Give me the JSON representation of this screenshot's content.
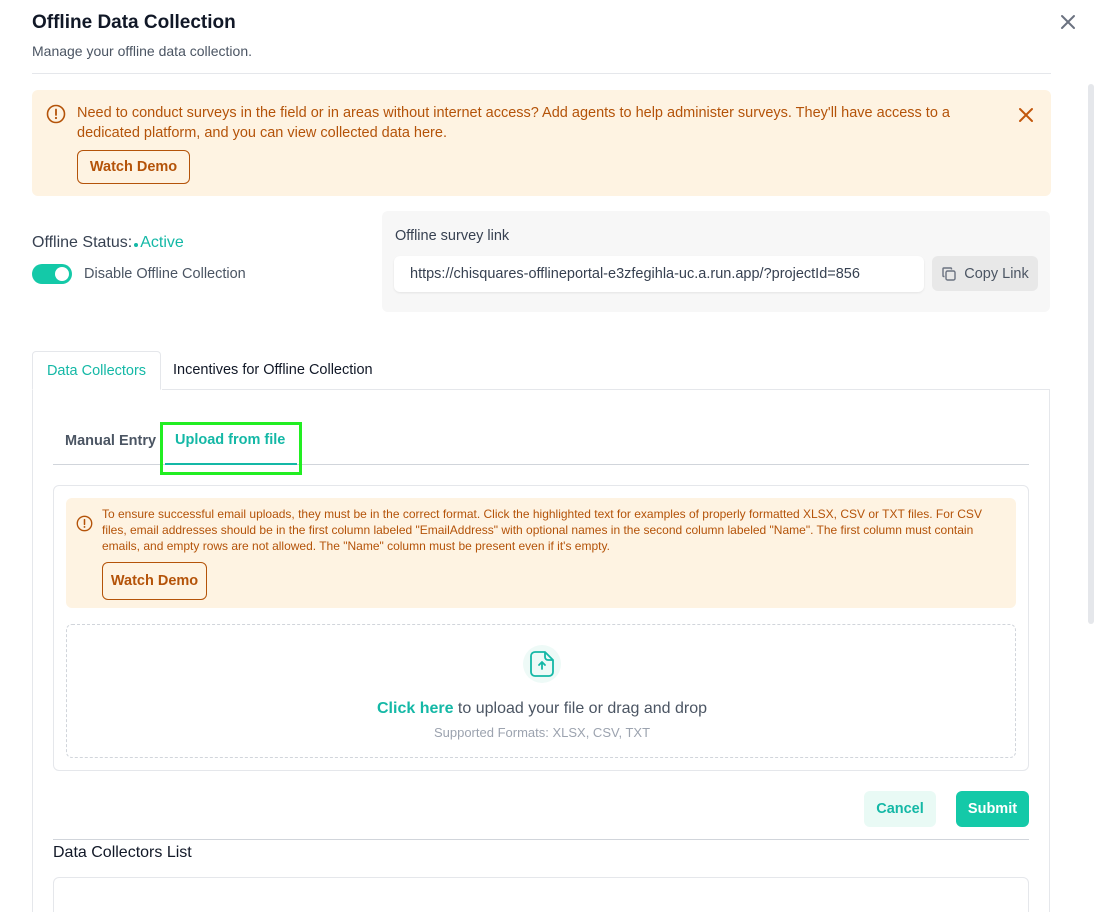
{
  "header": {
    "title": "Offline Data Collection",
    "subtitle": "Manage your offline data collection."
  },
  "banner": {
    "text": "Need to conduct surveys in the field or in areas without internet access? Add agents to help administer surveys. They'll have access to a dedicated platform, and you can view collected data here.",
    "watch_demo": "Watch Demo"
  },
  "status": {
    "label": "Offline Status:",
    "value": "Active",
    "toggle_label": "Disable Offline Collection",
    "toggle_on": true
  },
  "link": {
    "label": "Offline survey link",
    "url": "https://chisquares-offlineportal-e3zfegihla-uc.a.run.app/?projectId=856",
    "copy_label": "Copy Link"
  },
  "tabs": [
    {
      "label": "Data Collectors",
      "active": true
    },
    {
      "label": "Incentives for Offline Collection",
      "active": false
    }
  ],
  "subtabs": [
    {
      "label": "Manual Entry",
      "active": false
    },
    {
      "label": "Upload from file",
      "active": true
    }
  ],
  "upload": {
    "info_text": "To ensure successful email uploads, they must be in the correct format. Click the highlighted text for examples of properly formatted XLSX, CSV or TXT files. For CSV files, email addresses should be in the first column labeled \"EmailAddress\" with optional names in the second column labeled \"Name\". The first column must contain emails, and empty rows are not allowed. The \"Name\" column must be present even if it's empty.",
    "watch_demo": "Watch Demo",
    "click_here": "Click here",
    "drop_text": " to upload your file or drag and drop",
    "formats": "Supported Formats: XLSX, CSV, TXT"
  },
  "actions": {
    "cancel": "Cancel",
    "submit": "Submit"
  },
  "list": {
    "title": "Data Collectors List"
  },
  "colors": {
    "accent": "#14b8a6",
    "warning_bg": "#fef3e2",
    "warning_text": "#b45309",
    "highlight": "#22ee22"
  },
  "icons": {
    "close": "close-icon",
    "info": "info-circle-icon",
    "copy": "copy-icon",
    "upload": "upload-file-icon"
  }
}
